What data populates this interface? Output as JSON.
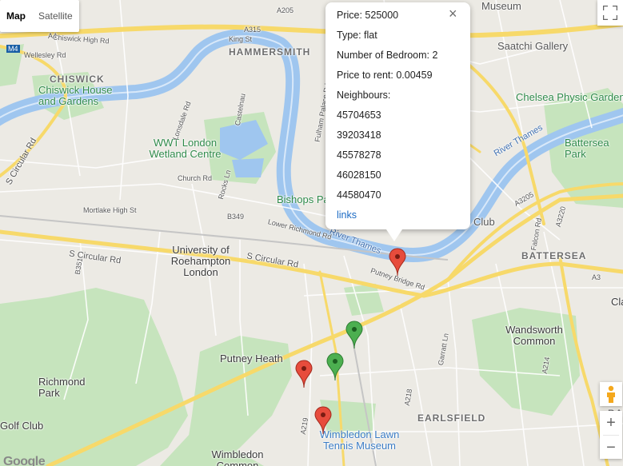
{
  "map_type": {
    "map": "Map",
    "satellite": "Satellite",
    "selected": "Map"
  },
  "labels": {
    "hammersmith": "HAMMERSMITH",
    "chiswick": "CHISWICK",
    "battersea": "BATTERSEA",
    "earlsfield": "EARLSFIELD",
    "chiswick_house": "Chiswick House and Gardens",
    "wwt": "WWT London Wetland Centre",
    "bishops": "Bishops Pa",
    "univ": "University of Roehampton London",
    "putney_heath": "Putney Heath",
    "richmond_park": "Richmond Park",
    "wandsworth": "Wandsworth Common",
    "wimbledon_tennis": "Wimbledon Lawn Tennis Museum",
    "wimbledon_common": "Wimbledon Common",
    "saatchi": "Saatchi Gallery",
    "chelsea": "Chelsea Physic Garden",
    "battersea_park": "Battersea Park",
    "museum": "Museum",
    "club": "Club",
    "golf": "Golf Club",
    "river_thames_1": "River Thames",
    "river_thames_2": "River Thames",
    "clapham": "Cla",
    "balham": "BALH",
    "a315": "A315",
    "a4": "A4",
    "a3": "A3",
    "a3205": "A3205",
    "a3220": "A3220",
    "a205": "A205",
    "a219": "A219",
    "a218": "A218",
    "a214": "A214",
    "b349": "B349",
    "b351": "B351",
    "m4": "M4",
    "s_circular_1": "S Circular Rd",
    "s_circular_2": "S Circular Rd",
    "s_circular_3": "S Circular Rd",
    "putney_bridge_rd": "Putney Bridge Rd",
    "lower_richmond": "Lower Richmond Rd",
    "mortlake": "Mortlake High St",
    "church_rd": "Church Rd",
    "rocks_ln": "Rocks Ln",
    "lonsdale": "Lonsdale Rd",
    "fulham_palace": "Fulham Palace Rd",
    "chiswick_high": "Chiswick High Rd",
    "wellesley": "Wellesley Rd",
    "kings_st": "King St",
    "castelnau": "Castelnau",
    "garratt": "Garratt Ln",
    "falcon": "Falcon Rd"
  },
  "popup": {
    "price": "Price: 525000",
    "type": "Type: flat",
    "bedrooms": "Number of Bedroom: 2",
    "price_to_rent": "Price to rent: 0.00459",
    "neighbours_label": "Neighbours:",
    "neighbours": [
      "45704653",
      "39203418",
      "45578278",
      "46028150",
      "44580470"
    ],
    "link": "links",
    "close": "×"
  },
  "markers": [
    {
      "color": "#e74c3c",
      "name": "selected"
    },
    {
      "color": "#4caf50",
      "name": "green-1"
    },
    {
      "color": "#4caf50",
      "name": "green-2"
    },
    {
      "color": "#e74c3c",
      "name": "red-2"
    },
    {
      "color": "#e74c3c",
      "name": "red-3"
    }
  ],
  "zoom": {
    "in": "+",
    "out": "−"
  },
  "attribution": "Google",
  "colors": {
    "park": "#c6e4bd",
    "water": "#9fc6ef",
    "land": "#eceae4",
    "major_road": "#f7d96a",
    "marker_red": "#e74c3c",
    "marker_green": "#4caf50"
  }
}
